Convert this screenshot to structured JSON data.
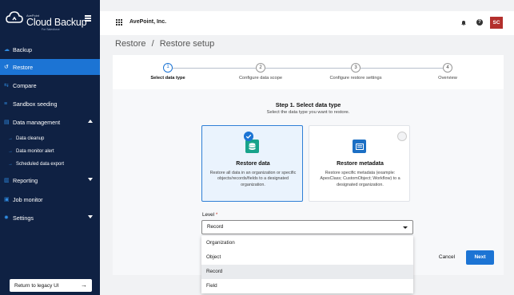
{
  "brand": {
    "vendor": "AvePoint",
    "product": "Cloud Backup",
    "subtitle": "For Salesforce"
  },
  "sidebar": {
    "items": [
      {
        "label": "Backup",
        "icon": "cloud-icon"
      },
      {
        "label": "Restore",
        "icon": "restore-icon",
        "active": true
      },
      {
        "label": "Compare",
        "icon": "compare-icon"
      },
      {
        "label": "Sandbox seeding",
        "icon": "seed-icon"
      },
      {
        "label": "Data management",
        "icon": "database-icon",
        "expanded": true
      },
      {
        "label": "Reporting",
        "icon": "chart-icon"
      },
      {
        "label": "Job monitor",
        "icon": "monitor-icon"
      },
      {
        "label": "Settings",
        "icon": "gear-icon"
      }
    ],
    "sub_items": [
      "Data cleanup",
      "Data monitor alert",
      "Scheduled data export"
    ],
    "legacy_label": "Return to legacy UI"
  },
  "topbar": {
    "org_name": "AvePoint, Inc.",
    "help": "?",
    "avatar_initials": "SC"
  },
  "breadcrumb": {
    "root": "Restore",
    "separator": "/",
    "current": "Restore setup",
    "text": "Restore  /  Restore setup"
  },
  "stepper": {
    "steps": [
      {
        "number": "1",
        "label": "Select data type",
        "active": true
      },
      {
        "number": "2",
        "label": "Configure data scope"
      },
      {
        "number": "3",
        "label": "Configure restore settings"
      },
      {
        "number": "4",
        "label": "Overview"
      }
    ]
  },
  "main": {
    "heading": "Step 1. Select data type",
    "subheading": "Select the data type you want to restore.",
    "options": [
      {
        "title": "Restore data",
        "description": "Restore all data in an organization or specific objects/records/fields to a designated organization.",
        "selected": true,
        "icon": "database-icon"
      },
      {
        "title": "Restore metadata",
        "description": "Restore specific metadata (example: ApexClass; CustomObject; Workflow) to a designated organization.",
        "selected": false,
        "icon": "list-icon"
      }
    ],
    "level_label": "Level",
    "level_required_mark": "*",
    "level_value": "Record",
    "level_options": [
      "Organization",
      "Object",
      "Record",
      "Field"
    ],
    "cancel_label": "Cancel",
    "next_label": "Next"
  },
  "colors": {
    "sidebar_bg": "#0f2143",
    "accent": "#1c74d4",
    "avatar_bg": "#b32f2c",
    "option_icon_green": "#17a38b",
    "option_icon_blue": "#1c6fc4"
  }
}
